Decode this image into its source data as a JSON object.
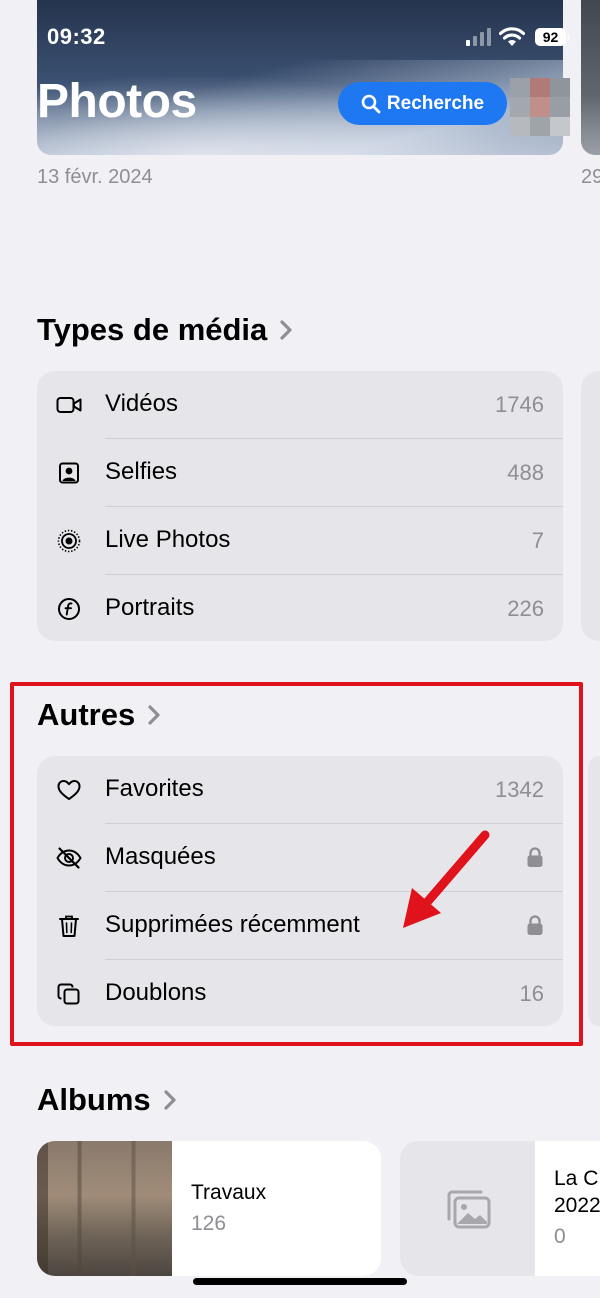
{
  "status_bar": {
    "time": "09:32",
    "battery": "92"
  },
  "header": {
    "title": "Photos",
    "search_label": "Recherche",
    "date_left": "13 févr. 2024",
    "date_right": "29"
  },
  "media_types": {
    "title": "Types de média",
    "items": [
      {
        "icon": "video-icon",
        "label": "Vidéos",
        "count": "1746"
      },
      {
        "icon": "selfie-icon",
        "label": "Selfies",
        "count": "488"
      },
      {
        "icon": "live-photo-icon",
        "label": "Live Photos",
        "count": "7"
      },
      {
        "icon": "portrait-icon",
        "label": "Portraits",
        "count": "226"
      }
    ]
  },
  "others": {
    "title": "Autres",
    "items": [
      {
        "icon": "heart-icon",
        "label": "Favorites",
        "count": "1342"
      },
      {
        "icon": "eye-slash-icon",
        "label": "Masquées",
        "locked": true
      },
      {
        "icon": "trash-icon",
        "label": "Supprimées récemment",
        "locked": true
      },
      {
        "icon": "duplicate-icon",
        "label": "Doublons",
        "count": "16"
      }
    ]
  },
  "albums": {
    "title": "Albums",
    "items": [
      {
        "title": "Travaux",
        "count": "126"
      },
      {
        "title_line1": "La C",
        "title_line2": "2022",
        "count": "0"
      }
    ]
  },
  "colors": {
    "accent": "#1d78f2",
    "annotation_red": "#e0121b",
    "background": "#f1f0f5",
    "card": "#e6e5ea",
    "secondary_text": "#8e8e93"
  }
}
